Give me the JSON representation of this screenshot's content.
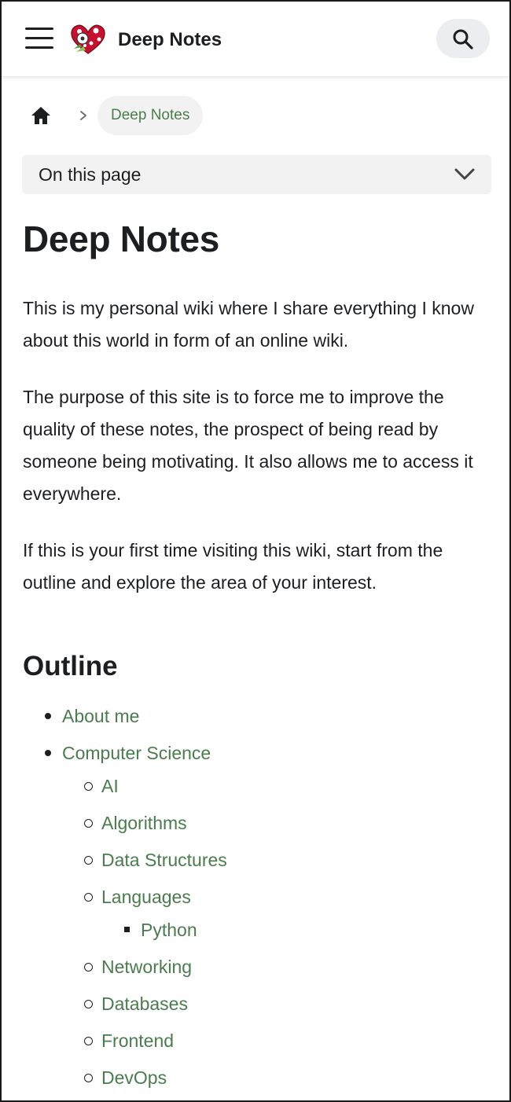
{
  "navbar": {
    "title": "Deep Notes",
    "menu_icon": "hamburger-menu-icon",
    "search_icon": "search-icon",
    "logo": "heart-logo"
  },
  "breadcrumbs": {
    "home_icon": "home-icon",
    "separator_icon": "chevron-right-icon",
    "current": "Deep Notes"
  },
  "toc": {
    "label": "On this page",
    "chevron_icon": "chevron-down-icon"
  },
  "article": {
    "title": "Deep Notes",
    "paragraphs": [
      "This is my personal wiki where I share everything I know about this world in form of an online wiki.",
      "The purpose of this site is to force me to improve the quality of these notes, the prospect of being read by someone being motivating. It also allows me to access it everywhere.",
      "If this is your first time visiting this wiki, start from the outline and explore the area of your interest."
    ],
    "outline_heading": "Outline",
    "outline": {
      "about": "About me",
      "cs": "Computer Science",
      "cs_items": {
        "ai": "AI",
        "algorithms": "Algorithms",
        "data_structures": "Data Structures",
        "languages": "Languages",
        "python": "Python",
        "networking": "Networking",
        "databases": "Databases",
        "frontend": "Frontend",
        "devops": "DevOps"
      }
    }
  },
  "colors": {
    "link": "#4a7c4e",
    "text": "#1c1e21",
    "pill_bg": "#f2f2f2",
    "search_bg": "#ebedf0"
  }
}
